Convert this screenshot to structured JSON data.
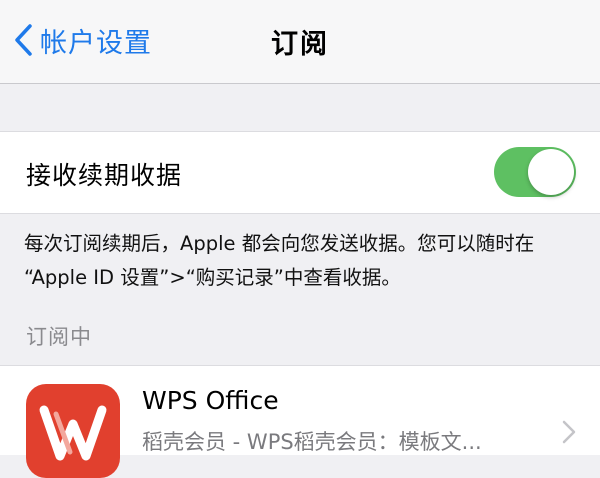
{
  "nav": {
    "back_label": "帐户设置",
    "title": "订阅"
  },
  "receipts": {
    "label": "接收续期收据",
    "toggle_on": true
  },
  "footnote": {
    "line1": "每次订阅续期后，Apple 都会向您发送收据。您可以随时在",
    "line2": "“Apple ID 设置”>“购买记录”中查看收据。"
  },
  "section_header": "订阅中",
  "subscription": {
    "app_name": "WPS Office",
    "detail": "稻壳会员 - WPS稻壳会员：模板文...",
    "icon": "wps-office-icon"
  },
  "colors": {
    "accent_blue": "#1f7aea",
    "toggle_green": "#5ec062",
    "wps_red": "#e1402e"
  }
}
